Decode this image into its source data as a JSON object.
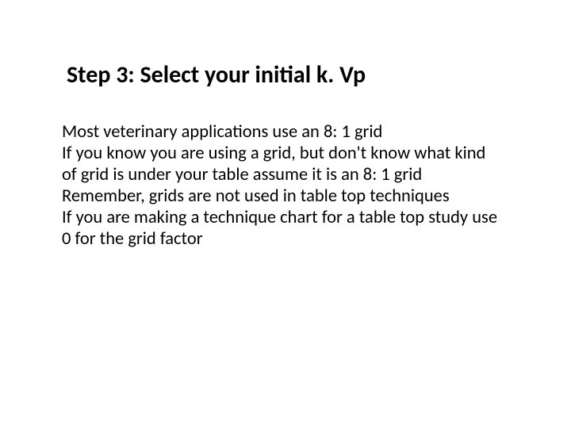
{
  "slide": {
    "title": "Step 3:  Select your initial k. Vp",
    "body": {
      "line1": "Most veterinary applications use an 8: 1 grid",
      "line2": "If you know you are using a grid, but don't know what kind of grid is under your table assume it is an 8: 1 grid",
      "line3": "Remember, grids are not used in table top techniques",
      "line4": "If you  are making a technique chart for a table top study use 0 for the grid factor"
    }
  }
}
